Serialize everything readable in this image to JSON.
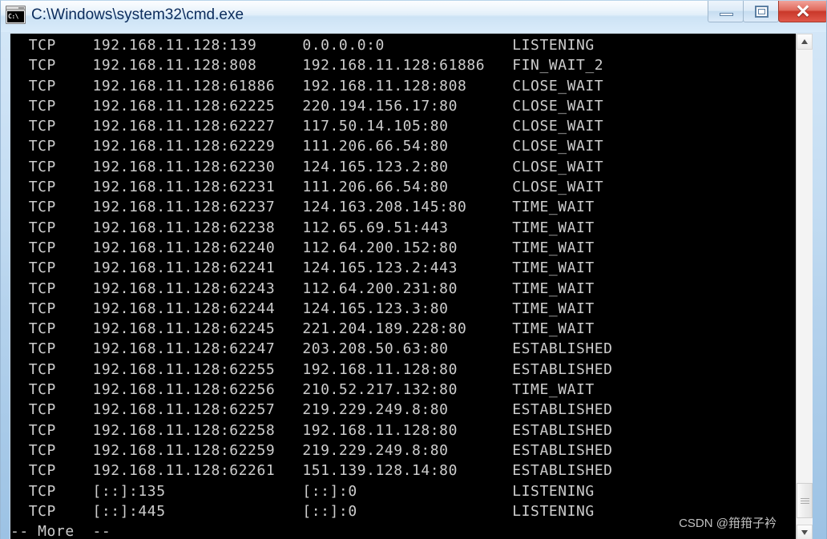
{
  "window": {
    "title": "C:\\Windows\\system32\\cmd.exe",
    "icon": "cmd-console-icon",
    "icon_text": "C:\\",
    "controls": {
      "minimize_label": "—",
      "maximize_label": "❐",
      "close_label": "✕"
    }
  },
  "console": {
    "background_color": "#000000",
    "foreground_color": "#cdcdcd",
    "lines": [
      "  TCP    192.168.11.128:139     0.0.0.0:0              LISTENING",
      "  TCP    192.168.11.128:808     192.168.11.128:61886   FIN_WAIT_2",
      "  TCP    192.168.11.128:61886   192.168.11.128:808     CLOSE_WAIT",
      "  TCP    192.168.11.128:62225   220.194.156.17:80      CLOSE_WAIT",
      "  TCP    192.168.11.128:62227   117.50.14.105:80       CLOSE_WAIT",
      "  TCP    192.168.11.128:62229   111.206.66.54:80       CLOSE_WAIT",
      "  TCP    192.168.11.128:62230   124.165.123.2:80       CLOSE_WAIT",
      "  TCP    192.168.11.128:62231   111.206.66.54:80       CLOSE_WAIT",
      "  TCP    192.168.11.128:62237   124.163.208.145:80     TIME_WAIT",
      "  TCP    192.168.11.128:62238   112.65.69.51:443       TIME_WAIT",
      "  TCP    192.168.11.128:62240   112.64.200.152:80      TIME_WAIT",
      "  TCP    192.168.11.128:62241   124.165.123.2:443      TIME_WAIT",
      "  TCP    192.168.11.128:62243   112.64.200.231:80      TIME_WAIT",
      "  TCP    192.168.11.128:62244   124.165.123.3:80       TIME_WAIT",
      "  TCP    192.168.11.128:62245   221.204.189.228:80     TIME_WAIT",
      "  TCP    192.168.11.128:62247   203.208.50.63:80       ESTABLISHED",
      "  TCP    192.168.11.128:62255   192.168.11.128:80      ESTABLISHED",
      "  TCP    192.168.11.128:62256   210.52.217.132:80      TIME_WAIT",
      "  TCP    192.168.11.128:62257   219.229.249.8:80       ESTABLISHED",
      "  TCP    192.168.11.128:62258   192.168.11.128:80      ESTABLISHED",
      "  TCP    192.168.11.128:62259   219.229.249.8:80       ESTABLISHED",
      "  TCP    192.168.11.128:62261   151.139.128.14:80      ESTABLISHED",
      "  TCP    [::]:135               [::]:0                 LISTENING",
      "  TCP    [::]:445               [::]:0                 LISTENING",
      "-- More  --"
    ],
    "more_prompt": "-- More  --"
  },
  "watermark": {
    "text": "CSDN @箝箝子衿"
  },
  "scrollbar": {
    "up_arrow": "scroll-up-arrow",
    "down_arrow": "scroll-down-arrow",
    "position": "bottom"
  }
}
